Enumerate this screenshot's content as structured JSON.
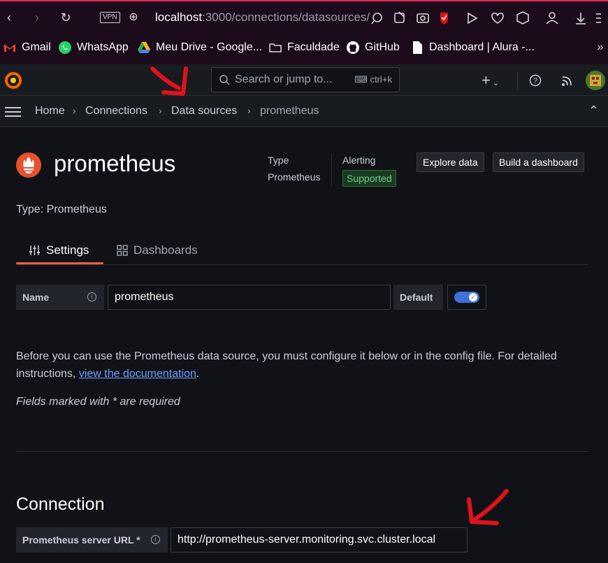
{
  "browser": {
    "vpn_label": "VPN",
    "url_host": "localhost",
    "url_rest": ":3000/connections/datasources/",
    "bookmarks": [
      "Gmail",
      "WhatsApp",
      "Meu Drive - Google...",
      "Faculdade",
      "GitHub",
      "Dashboard | Alura -..."
    ]
  },
  "topbar": {
    "search_placeholder": "Search or jump to...",
    "shortcut": "ctrl+k"
  },
  "breadcrumb": [
    "Home",
    "Connections",
    "Data sources",
    "prometheus"
  ],
  "header": {
    "title": "prometheus",
    "type_label": "Type",
    "type_value": "Prometheus",
    "alerting_label": "Alerting",
    "alerting_value": "Supported",
    "explore_btn": "Explore data",
    "dashboard_btn": "Build a dashboard",
    "type_line": "Type: Prometheus"
  },
  "tabs": [
    "Settings",
    "Dashboards"
  ],
  "name_field": {
    "label": "Name",
    "value": "prometheus",
    "default_label": "Default",
    "default_on": true
  },
  "description": {
    "text_before": "Before you can use the Prometheus data source, you must configure it below or in the config file. For detailed instructions, ",
    "link": "view the documentation",
    "text_after": ".",
    "required_note": "Fields marked with * are required"
  },
  "connection": {
    "heading": "Connection",
    "url_label": "Prometheus server URL *",
    "url_value": "http://prometheus-server.monitoring.svc.cluster.local"
  },
  "colors": {
    "accent": "#f55f3e",
    "annotation_arrow": "#e0121a",
    "toggle": "#3d71d9"
  }
}
